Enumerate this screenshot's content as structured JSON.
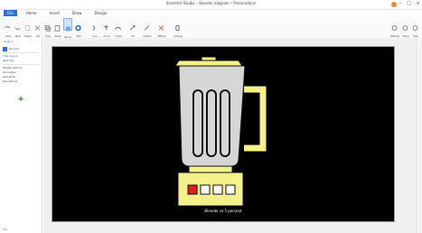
{
  "window": {
    "title": "SmartArt Studio – Blender diagram – Presentation"
  },
  "tabs": [
    "File",
    "Home",
    "Insert",
    "Draw",
    "Design"
  ],
  "ribbon": {
    "buttons": [
      {
        "label": "Undo"
      },
      {
        "label": "Redo"
      },
      {
        "label": "Select"
      },
      {
        "label": "Cut"
      },
      {
        "label": "Copy"
      },
      {
        "label": "Paste"
      },
      {
        "label": "Shape"
      },
      {
        "label": "Text"
      },
      {
        "label": "Line"
      },
      {
        "label": "Arrow"
      },
      {
        "label": "Curve"
      },
      {
        "label": "Fill"
      },
      {
        "label": "Outline"
      },
      {
        "label": "Effects"
      },
      {
        "label": "Arrange"
      }
    ],
    "right_buttons": [
      {
        "label": "Settings"
      },
      {
        "label": "Share"
      },
      {
        "label": "Help"
      }
    ]
  },
  "left_panel": {
    "items": [
      "Slide 1",
      "Blender",
      "Title layout",
      "Text box",
      "Shape options",
      "Animation",
      "Add slide",
      "Transitions"
    ],
    "bottom_label": "1/1"
  },
  "slide": {
    "caption": "Blender at 5 percent",
    "colors": {
      "background": "#000000",
      "body": "#f4f08a",
      "jar": "#d6d6d6",
      "outline": "#111111",
      "red_button": "#e02020"
    }
  }
}
